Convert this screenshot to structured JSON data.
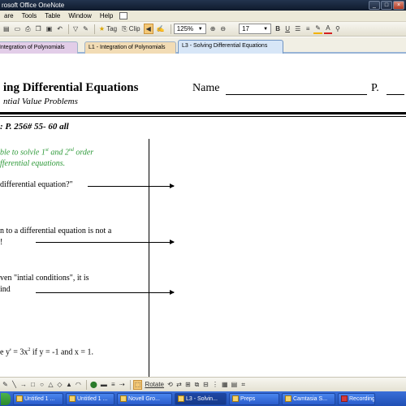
{
  "window": {
    "title": "rosoft Office OneNote",
    "min_label": "_",
    "max_label": "□",
    "close_label": "×"
  },
  "menu": {
    "items": [
      "are",
      "Tools",
      "Table",
      "Window",
      "Help"
    ]
  },
  "toolbar": {
    "tag_label": "Tag",
    "clip_label": "Clip",
    "zoom_value": "125%",
    "font_size_value": "17",
    "bold": "B",
    "underline": "U"
  },
  "tabs": [
    {
      "label": "Integration of Polynomials"
    },
    {
      "label": "L1 - Integration of Polynomials"
    },
    {
      "label": "L3 - Solving Differential Equations"
    }
  ],
  "page": {
    "title": "ing Differential Equations",
    "subtitle": "ntial Value Problems",
    "name_label": "Name",
    "p_label": "P.",
    "homework": ":  P. 256# 55- 60 all",
    "goal_line1_a": "ble to solvle 1",
    "goal_line1_sup1": "st",
    "goal_line1_b": " and 2",
    "goal_line1_sup2": "nd",
    "goal_line1_c": " order",
    "goal_line2": "fferential equations.",
    "note1": "differential equation?\"",
    "note2_line1": "n to a differential equation is not a",
    "note2_line2": "!",
    "note3_line1": "ven \"intial conditions\", it is",
    "note3_line2": "ind",
    "note4_a": "e  y' = 3x",
    "note4_sup": "2",
    "note4_b": "  if y = -1 and x = 1."
  },
  "drawbar": {
    "rotate_label": "Rotate"
  },
  "taskbar": {
    "items": [
      {
        "label": "Untitled 1 ..."
      },
      {
        "label": "Untitled 1 ..."
      },
      {
        "label": "Novell Gro..."
      },
      {
        "label": "L3 - Solvin..."
      },
      {
        "label": "Preps"
      },
      {
        "label": "Camtasia S..."
      },
      {
        "label": "Recording..."
      }
    ]
  }
}
